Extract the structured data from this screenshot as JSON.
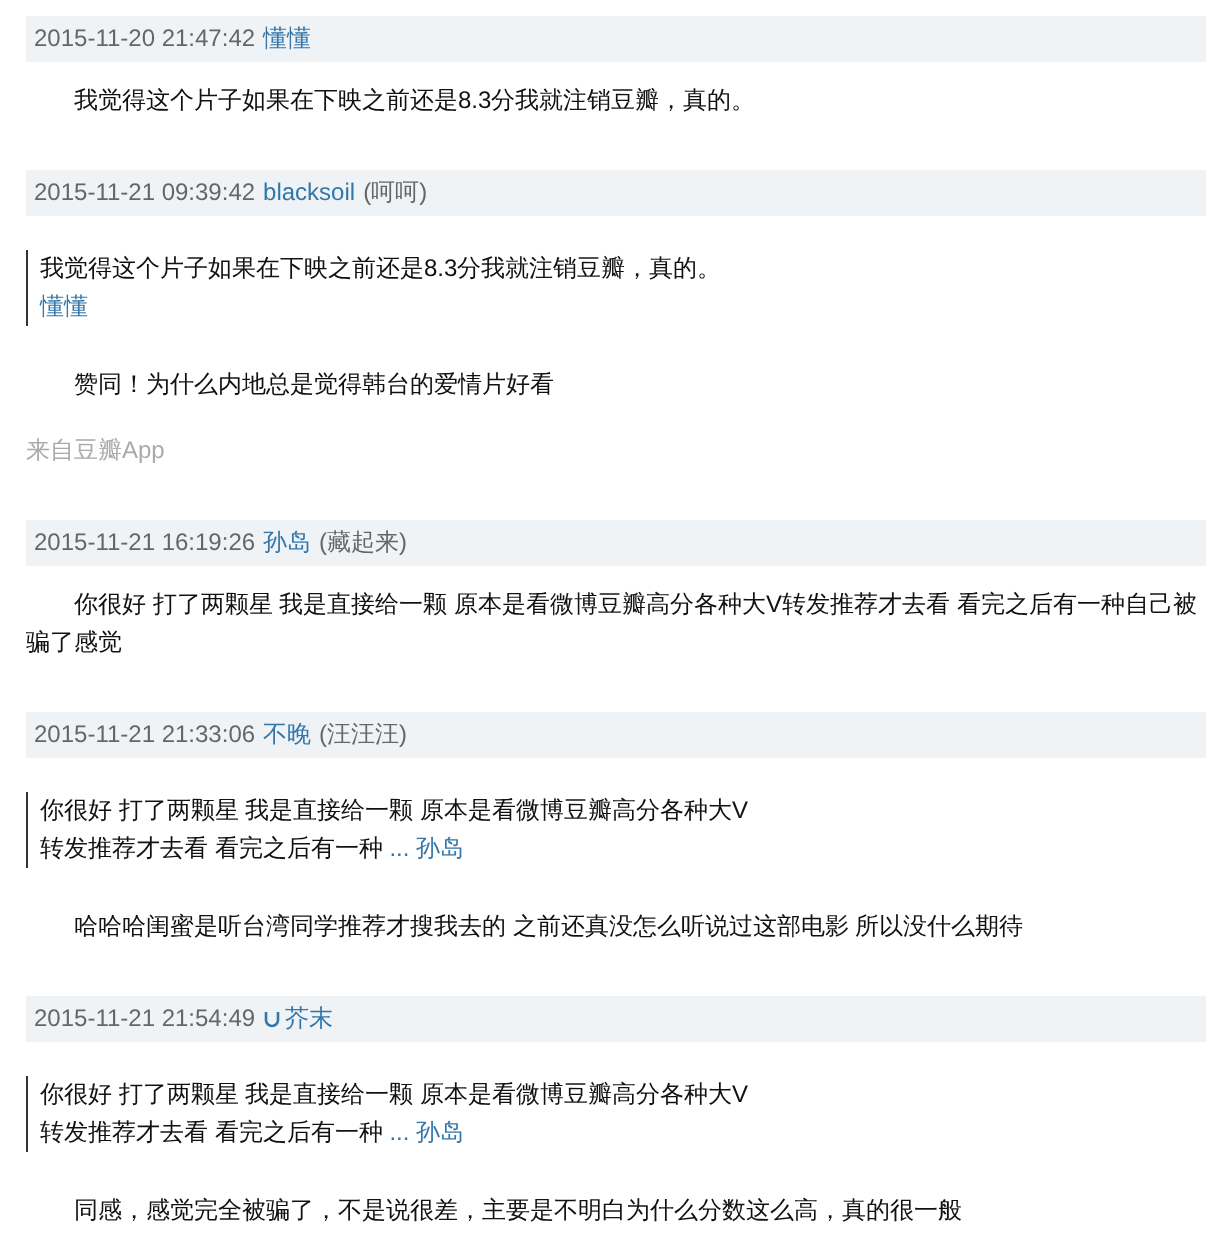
{
  "comments": [
    {
      "time": "2015-11-20 21:47:42",
      "author": "懂懂",
      "badge": false,
      "text": "我觉得这个片子如果在下映之前还是8.3分我就注销豆瓣，真的。"
    },
    {
      "time": "2015-11-21 09:39:42",
      "author": "blacksoil",
      "badge": false,
      "note": "(呵呵)",
      "quote": {
        "text": "我觉得这个片子如果在下映之前还是8.3分我就注销豆瓣，真的。",
        "author": "懂懂"
      },
      "text": "赞同！为什么内地总是觉得韩台的爱情片好看",
      "source": "来自豆瓣App"
    },
    {
      "time": "2015-11-21 16:19:26",
      "author": "孙岛",
      "badge": false,
      "note": "(藏起来)",
      "text": "你很好 打了两颗星 我是直接给一颗 原本是看微博豆瓣高分各种大V转发推荐才去看 看完之后有一种自己被骗了感觉"
    },
    {
      "time": "2015-11-21 21:33:06",
      "author": "不晚",
      "badge": false,
      "note": "(汪汪汪)",
      "quote": {
        "text": "你很好 打了两颗星 我是直接给一颗 原本是看微博豆瓣高分各种大V转发推荐才去看 看完之后有一种",
        "author": "... 孙岛"
      },
      "text": "哈哈哈闺蜜是听台湾同学推荐才搜我去的 之前还真没怎么听说过这部电影 所以没什么期待"
    },
    {
      "time": "2015-11-21 21:54:49",
      "author": "芥末",
      "badge": true,
      "quote": {
        "text": "你很好 打了两颗星 我是直接给一颗 原本是看微博豆瓣高分各种大V转发推荐才去看 看完之后有一种",
        "author": "... 孙岛"
      },
      "text": "同感，感觉完全被骗了，不是说很差，主要是不明白为什么分数这么高，真的很一般"
    }
  ]
}
